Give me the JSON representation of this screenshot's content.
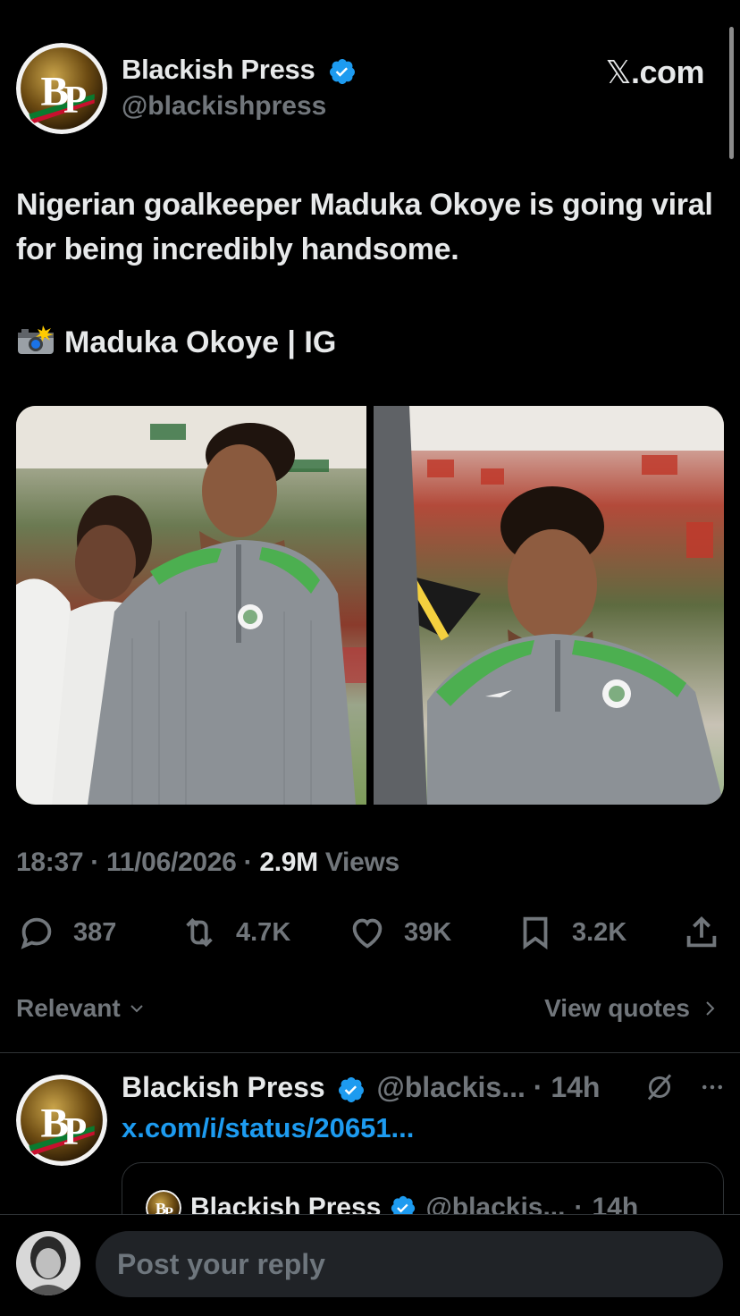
{
  "post": {
    "author_name": "Blackish Press",
    "author_handle": "@blackishpress",
    "site_brand": "X.com",
    "site_brand_x": "𝕏",
    "site_brand_suffix": ".com",
    "text": "Nigerian goalkeeper Maduka Okoye is going viral for being incredibly handsome.",
    "credit": "Maduka Okoye | IG",
    "time": "18:37",
    "date": "11/06/2026",
    "views_count": "2.9M",
    "views_label": "Views",
    "separator": "·"
  },
  "actions": {
    "replies": "387",
    "reposts": "4.7K",
    "likes": "39K",
    "bookmarks": "3.2K"
  },
  "sort": {
    "label": "Relevant",
    "view_quotes": "View quotes"
  },
  "reply": {
    "author_name": "Blackish Press",
    "author_handle": "@blackis...",
    "age": "14h",
    "link": "x.com/i/status/20651...",
    "quote_author": "Blackish Press",
    "quote_handle": "@blackis...",
    "quote_age": "14h"
  },
  "composer": {
    "placeholder": "Post your reply"
  },
  "colors": {
    "background": "#000000",
    "text_primary": "#e7e9ea",
    "text_secondary": "#71767b",
    "accent_blue": "#1d9bf0",
    "verified": "#1d9bf0"
  },
  "icons": [
    "verified-badge-icon",
    "camera-flash-icon",
    "reply-icon",
    "repost-icon",
    "like-icon",
    "bookmark-icon",
    "share-icon",
    "chevron-down-icon",
    "chevron-right-icon",
    "grok-icon",
    "more-icon"
  ]
}
